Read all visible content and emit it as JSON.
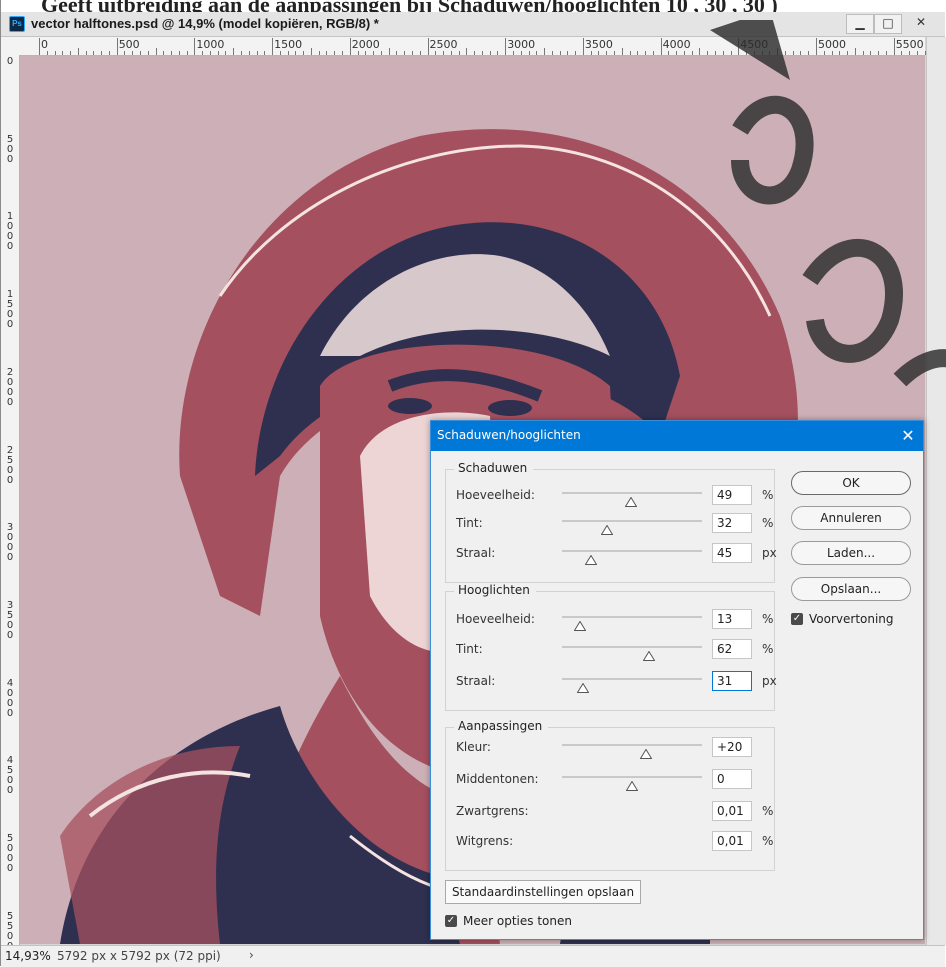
{
  "window": {
    "title": "vector halftones.psd @ 14,9% (model kopiëren, RGB/8) *",
    "top_text": "Geeft uitbreiding aan de aanpassingen bij Schaduwen/hooglichten  10 , 30 , 30 )",
    "app_icon": "Ps"
  },
  "ruler_h": [
    "0",
    "500",
    "1000",
    "1500",
    "2000",
    "2500",
    "3000",
    "3500",
    "4000",
    "4500",
    "5000",
    "5500"
  ],
  "ruler_v": [
    [
      "0"
    ],
    [
      "5",
      "0",
      "0"
    ],
    [
      "1",
      "0",
      "0",
      "0"
    ],
    [
      "1",
      "5",
      "0",
      "0"
    ],
    [
      "2",
      "0",
      "0",
      "0"
    ],
    [
      "2",
      "5",
      "0",
      "0"
    ],
    [
      "3",
      "0",
      "0",
      "0"
    ],
    [
      "3",
      "5",
      "0",
      "0"
    ],
    [
      "4",
      "0",
      "0",
      "0"
    ],
    [
      "4",
      "5",
      "0",
      "0"
    ],
    [
      "5",
      "0",
      "0",
      "0"
    ],
    [
      "5",
      "5",
      "0",
      "0"
    ]
  ],
  "status": {
    "zoom": "14,93%",
    "doc_size": "5792 px x 5792 px (72 ppi)",
    "arrow": "›"
  },
  "colors": {
    "background": "#cdb0b7",
    "mid": "#a4505e",
    "dark": "#2f3050",
    "light": "#f4e3e1",
    "dialog_accent": "#0078d7"
  },
  "dialog": {
    "title": "Schaduwen/hooglichten",
    "close": "✕",
    "groups": [
      {
        "title": "Schaduwen",
        "rows": [
          {
            "label": "Hoeveelheid:",
            "value": "49",
            "unit": "%",
            "slider": 0.49
          },
          {
            "label": "Tint:",
            "value": "32",
            "unit": "%",
            "slider": 0.32
          },
          {
            "label": "Straal:",
            "value": "45",
            "unit": "px",
            "slider": 0.21
          }
        ]
      },
      {
        "title": "Hooglichten",
        "rows": [
          {
            "label": "Hoeveelheid:",
            "value": "13",
            "unit": "%",
            "slider": 0.13
          },
          {
            "label": "Tint:",
            "value": "62",
            "unit": "%",
            "slider": 0.62
          },
          {
            "label": "Straal:",
            "value": "31",
            "unit": "px",
            "slider": 0.15
          }
        ]
      },
      {
        "title": "Aanpassingen",
        "rows": [
          {
            "label": "Kleur:",
            "value": "+20",
            "unit": "",
            "slider": 0.6
          },
          {
            "label": "Middentonen:",
            "value": "0",
            "unit": "",
            "slider": 0.5
          },
          {
            "label": "Zwartgrens:",
            "value": "0,01",
            "unit": "%"
          },
          {
            "label": "Witgrens:",
            "value": "0,01",
            "unit": "%"
          }
        ]
      }
    ],
    "buttons": {
      "ok": "OK",
      "cancel": "Annuleren",
      "load": "Laden...",
      "save": "Opslaan..."
    },
    "preview_label": "Voorvertoning",
    "save_defaults": "Standaardinstellingen opslaan",
    "more_options": "Meer opties tonen"
  }
}
